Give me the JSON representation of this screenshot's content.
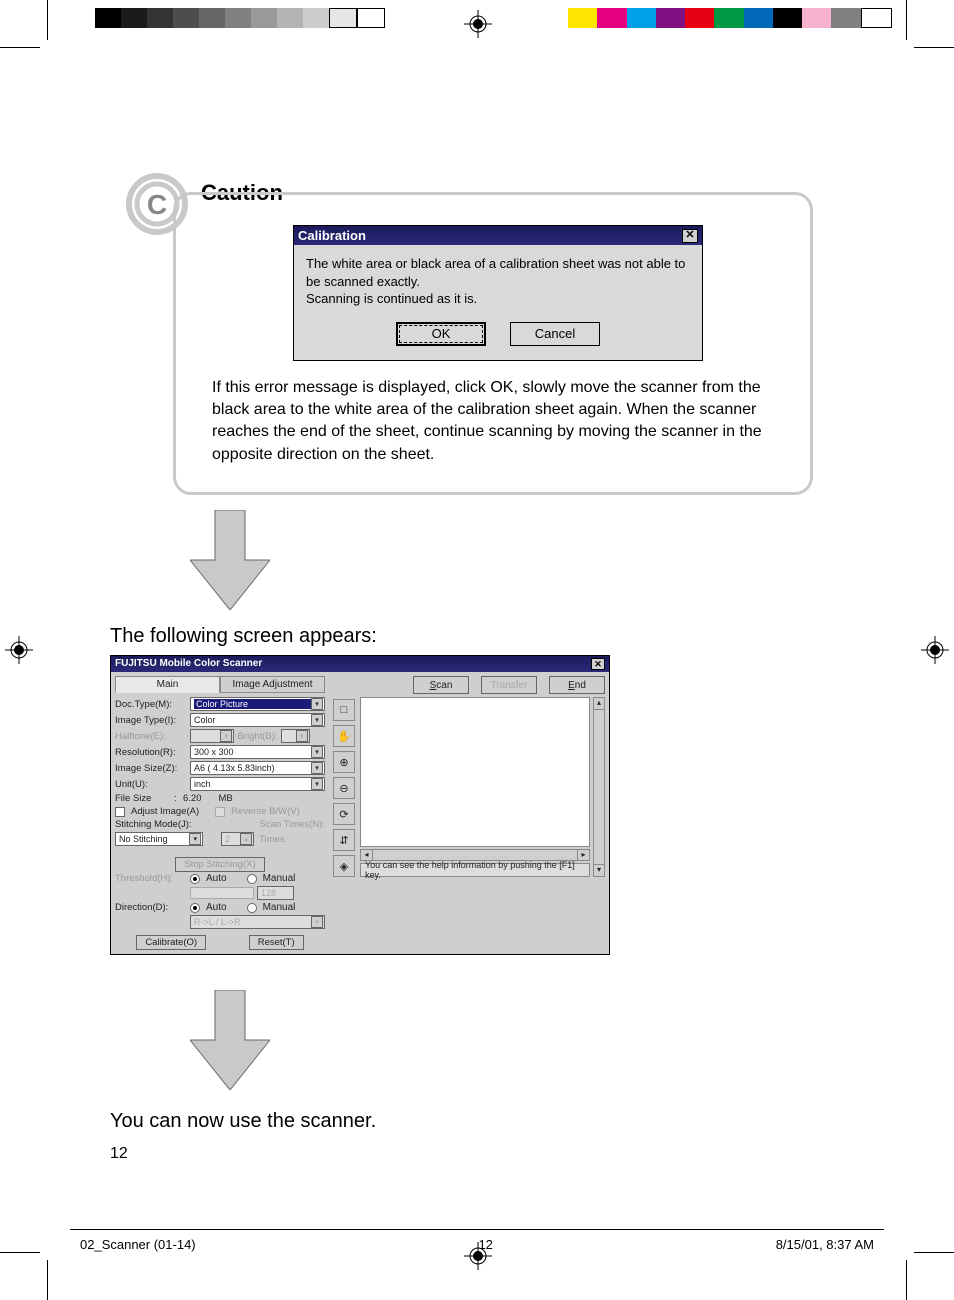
{
  "caution": {
    "title": "Caution",
    "dialog": {
      "title": "Calibration",
      "message_line1": "The white area or black area of a calibration sheet was not able to be scanned exactly.",
      "message_line2": "Scanning is continued as it is.",
      "ok": "OK",
      "cancel": "Cancel"
    },
    "body": "If this error message is displayed, click OK, slowly move the scanner from the black area to the white area of the calibration sheet again. When the scanner reaches the end of the sheet, continue scanning by moving the scanner in the opposite direction on the sheet."
  },
  "lead1": "The following screen appears:",
  "lead2": "You can now use the scanner.",
  "page_number": "12",
  "footer": {
    "left": "02_Scanner (01-14)",
    "center": "12",
    "right": "8/15/01, 8:37 AM"
  },
  "scanner": {
    "title": "FUJITSU Mobile Color Scanner",
    "tabs": {
      "main": "Main",
      "adjust": "Image Adjustment"
    },
    "buttons": {
      "scan": "Scan",
      "transfer": "Transfer",
      "end": "End"
    },
    "labels": {
      "doc_type": "Doc.Type(M):",
      "image_type": "Image Type(I):",
      "halftone": "Halftone(E):",
      "bright": "Bright(B):",
      "resolution": "Resolution(R):",
      "image_size": "Image Size(Z):",
      "unit": "Unit(U):",
      "file_size": "File Size",
      "adjust_image": "Adjust Image(A)",
      "reverse_bw": "Reverse B/W(V)",
      "stitching_mode": "Stitching Mode(J):",
      "scan_times": "Scan Times(N):",
      "times_suffix": "Times",
      "stop_stitching": "Stop Stitching(X)",
      "threshold": "Threshold(H):",
      "direction": "Direction(D):",
      "auto": "Auto",
      "manual": "Manual",
      "calibrate": "Calibrate(O)",
      "reset": "Reset(T)",
      "dir_text": "R->L / L->R"
    },
    "values": {
      "doc_type": "Color Picture",
      "image_type": "Color",
      "halftone": "",
      "bright": "",
      "resolution": "300 x 300",
      "image_size": "A6 ( 4.13x 5.83inch)",
      "unit": "inch",
      "file_size_val": "6.20",
      "file_size_unit": "MB",
      "stitching": "No Stitching",
      "scan_times": "2",
      "threshold_num": "128"
    },
    "icons": {
      "select_tool": "□",
      "hand_tool": "✋",
      "zoom_in": "⊕",
      "zoom_out": "⊖",
      "rotate": "⟳",
      "flip": "⇵",
      "scan_icon": "◈"
    },
    "status": "You can see the help information by pushing the [F1] key."
  }
}
